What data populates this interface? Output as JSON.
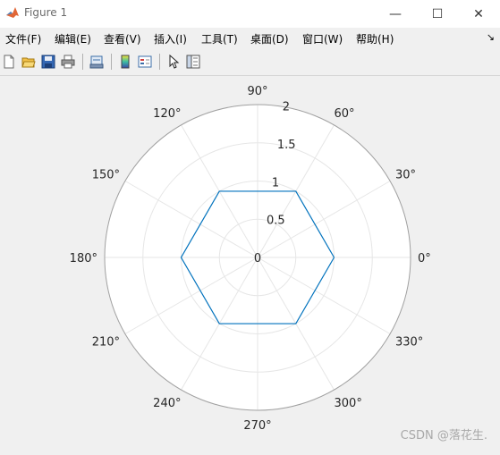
{
  "window": {
    "title": "Figure 1",
    "minimize": "—",
    "maximize": "☐",
    "close": "✕"
  },
  "menu": {
    "items": [
      "文件(F)",
      "编辑(E)",
      "查看(V)",
      "插入(I)",
      "工具(T)",
      "桌面(D)",
      "窗口(W)",
      "帮助(H)"
    ],
    "overflow_arrow": "↘"
  },
  "toolbar": {
    "icons": [
      "new-figure-icon",
      "open-file-icon",
      "save-icon",
      "print-icon",
      "link-plot-icon",
      "colorbar-icon",
      "legend-icon",
      "pointer-icon",
      "property-inspector-icon"
    ]
  },
  "chart_data": {
    "type": "polar-line",
    "theta_tick_labels": [
      "0°",
      "30°",
      "60°",
      "90°",
      "120°",
      "150°",
      "180°",
      "210°",
      "240°",
      "270°",
      "300°",
      "330°"
    ],
    "r_tick_labels": [
      "0",
      "0.5",
      "1",
      "1.5",
      "2"
    ],
    "rlim": [
      0,
      2
    ],
    "grid": true,
    "series": [
      {
        "color": "#0072bd",
        "theta_deg": [
          0,
          60,
          120,
          180,
          240,
          300,
          360
        ],
        "r": [
          1,
          1,
          1,
          1,
          1,
          1,
          1
        ]
      }
    ]
  },
  "watermark": "CSDN @落花生."
}
